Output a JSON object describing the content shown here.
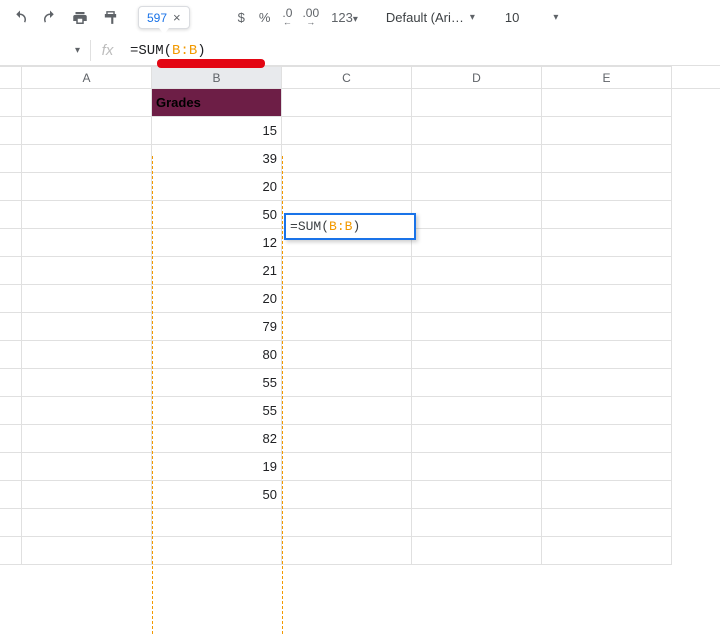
{
  "toolbar": {
    "currency_icon": "$",
    "percent_icon": "%",
    "dec_dec": ".0",
    "inc_dec": ".00",
    "format_123": "123",
    "font_name": "Default (Ari…",
    "font_size": "10"
  },
  "formula_result": {
    "value": "597",
    "close": "×"
  },
  "fx_bar": {
    "label": "fx",
    "formula_eq": "=",
    "formula_fn": "SUM",
    "formula_open": "(",
    "formula_ref": "B:B",
    "formula_close": ")"
  },
  "columns": [
    "A",
    "B",
    "C",
    "D",
    "E"
  ],
  "column_b": {
    "header": "Grades",
    "values": [
      15,
      39,
      20,
      50,
      12,
      21,
      20,
      79,
      80,
      55,
      55,
      82,
      19,
      50
    ]
  },
  "active_cell": {
    "formula_eq": "=",
    "formula_fn": "SUM",
    "formula_open": "(",
    "formula_ref": "B:B",
    "formula_close": ")"
  }
}
